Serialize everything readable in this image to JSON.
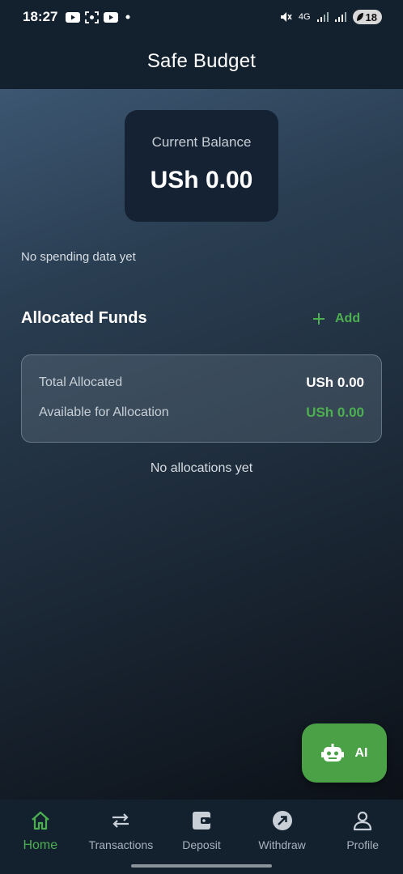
{
  "status_bar": {
    "time": "18:27",
    "battery": "18",
    "network": "4G"
  },
  "app_bar": {
    "title": "Safe Budget"
  },
  "balance": {
    "label": "Current Balance",
    "value": "USh 0.00"
  },
  "spending": {
    "empty_text": "No spending data yet"
  },
  "allocated": {
    "title": "Allocated Funds",
    "add_label": "Add",
    "total_label": "Total Allocated",
    "total_value": "USh 0.00",
    "available_label": "Available for Allocation",
    "available_value": "USh 0.00",
    "empty_text": "No allocations yet"
  },
  "ai_button": {
    "label": "AI"
  },
  "nav": {
    "items": [
      {
        "label": "Home",
        "icon": "home-icon",
        "active": true
      },
      {
        "label": "Transactions",
        "icon": "swap-arrows-icon",
        "active": false
      },
      {
        "label": "Deposit",
        "icon": "wallet-icon",
        "active": false
      },
      {
        "label": "Withdraw",
        "icon": "arrow-up-right-icon",
        "active": false
      },
      {
        "label": "Profile",
        "icon": "person-icon",
        "active": false
      }
    ]
  },
  "colors": {
    "accent_green": "#4caf50",
    "app_bar": "#13212f",
    "card_dark": "#142233"
  }
}
